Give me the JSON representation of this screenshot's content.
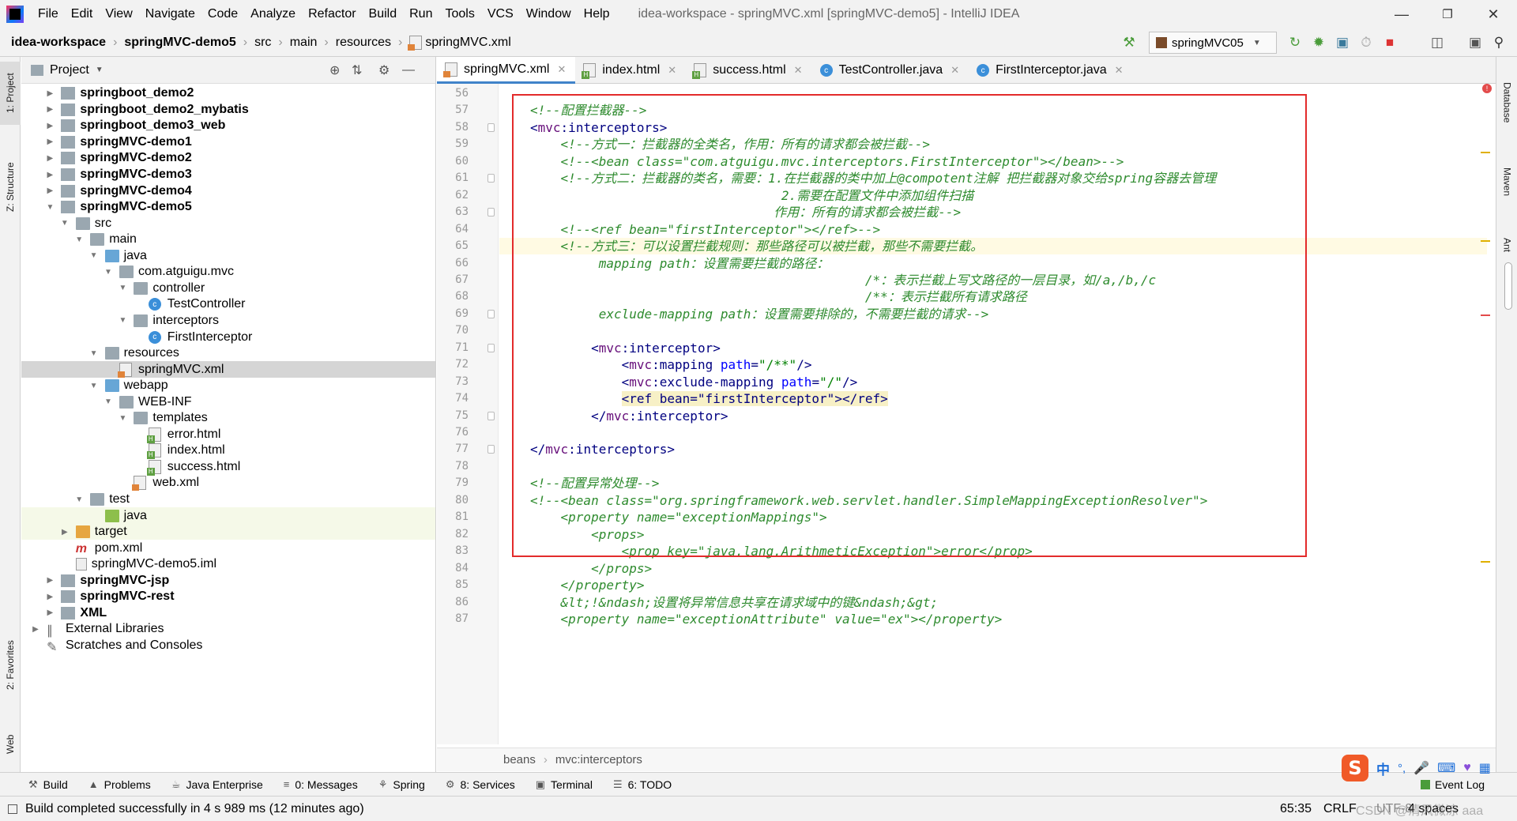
{
  "menubar": {
    "items": [
      "File",
      "Edit",
      "View",
      "Navigate",
      "Code",
      "Analyze",
      "Refactor",
      "Build",
      "Run",
      "Tools",
      "VCS",
      "Window",
      "Help"
    ],
    "window_title": "idea-workspace - springMVC.xml [springMVC-demo5] - IntelliJ IDEA",
    "minimize": "—",
    "maximize": "❐",
    "close": "✕"
  },
  "navbar": {
    "crumbs": [
      "idea-workspace",
      "springMVC-demo5",
      "src",
      "main",
      "resources",
      "springMVC.xml"
    ],
    "run_config": "springMVC05",
    "dropdown": "▼"
  },
  "left_stripe": {
    "project": "1: Project",
    "structure": "Z: Structure",
    "favorites": "2: Favorites",
    "web": "Web"
  },
  "project_panel": {
    "title": "Project",
    "tree": [
      {
        "label": "springboot_demo2",
        "depth": 1,
        "arrow": "▶",
        "icon": "module",
        "bold": true
      },
      {
        "label": "springboot_demo2_mybatis",
        "depth": 1,
        "arrow": "▶",
        "icon": "module",
        "bold": true
      },
      {
        "label": "springboot_demo3_web",
        "depth": 1,
        "arrow": "▶",
        "icon": "module",
        "bold": true
      },
      {
        "label": "springMVC-demo1",
        "depth": 1,
        "arrow": "▶",
        "icon": "module",
        "bold": true
      },
      {
        "label": "springMVC-demo2",
        "depth": 1,
        "arrow": "▶",
        "icon": "module",
        "bold": true
      },
      {
        "label": "springMVC-demo3",
        "depth": 1,
        "arrow": "▶",
        "icon": "module",
        "bold": true
      },
      {
        "label": "springMVC-demo4",
        "depth": 1,
        "arrow": "▶",
        "icon": "module",
        "bold": true
      },
      {
        "label": "springMVC-demo5",
        "depth": 1,
        "arrow": "▼",
        "icon": "module",
        "bold": true
      },
      {
        "label": "src",
        "depth": 2,
        "arrow": "▼",
        "icon": "folder"
      },
      {
        "label": "main",
        "depth": 3,
        "arrow": "▼",
        "icon": "folder"
      },
      {
        "label": "java",
        "depth": 4,
        "arrow": "▼",
        "icon": "folder-blue"
      },
      {
        "label": "com.atguigu.mvc",
        "depth": 5,
        "arrow": "▼",
        "icon": "folder"
      },
      {
        "label": "controller",
        "depth": 6,
        "arrow": "▼",
        "icon": "folder"
      },
      {
        "label": "TestController",
        "depth": 7,
        "arrow": "",
        "icon": "class"
      },
      {
        "label": "interceptors",
        "depth": 6,
        "arrow": "▼",
        "icon": "folder"
      },
      {
        "label": "FirstInterceptor",
        "depth": 7,
        "arrow": "",
        "icon": "class"
      },
      {
        "label": "resources",
        "depth": 4,
        "arrow": "▼",
        "icon": "folder"
      },
      {
        "label": "springMVC.xml",
        "depth": 5,
        "arrow": "",
        "icon": "xml",
        "selected": true
      },
      {
        "label": "webapp",
        "depth": 4,
        "arrow": "▼",
        "icon": "folder-blue"
      },
      {
        "label": "WEB-INF",
        "depth": 5,
        "arrow": "▼",
        "icon": "folder"
      },
      {
        "label": "templates",
        "depth": 6,
        "arrow": "▼",
        "icon": "folder"
      },
      {
        "label": "error.html",
        "depth": 7,
        "arrow": "",
        "icon": "html"
      },
      {
        "label": "index.html",
        "depth": 7,
        "arrow": "",
        "icon": "html"
      },
      {
        "label": "success.html",
        "depth": 7,
        "arrow": "",
        "icon": "html"
      },
      {
        "label": "web.xml",
        "depth": 6,
        "arrow": "",
        "icon": "xml"
      },
      {
        "label": "test",
        "depth": 3,
        "arrow": "▼",
        "icon": "folder"
      },
      {
        "label": "java",
        "depth": 4,
        "arrow": "",
        "icon": "folder-green",
        "highlight": true
      },
      {
        "label": "target",
        "depth": 2,
        "arrow": "▶",
        "icon": "folder-orange",
        "highlight": true
      },
      {
        "label": "pom.xml",
        "depth": 2,
        "arrow": "",
        "icon": "maven"
      },
      {
        "label": "springMVC-demo5.iml",
        "depth": 2,
        "arrow": "",
        "icon": "iml"
      },
      {
        "label": "springMVC-jsp",
        "depth": 1,
        "arrow": "▶",
        "icon": "module",
        "bold": true
      },
      {
        "label": "springMVC-rest",
        "depth": 1,
        "arrow": "▶",
        "icon": "module",
        "bold": true
      },
      {
        "label": "XML",
        "depth": 1,
        "arrow": "▶",
        "icon": "module",
        "bold": true
      },
      {
        "label": "External Libraries",
        "depth": 0,
        "arrow": "▶",
        "icon": "libs"
      },
      {
        "label": "Scratches and Consoles",
        "depth": 0,
        "arrow": "",
        "icon": "scratch"
      }
    ]
  },
  "tabs": [
    {
      "label": "springMVC.xml",
      "icon": "xml",
      "active": true
    },
    {
      "label": "index.html",
      "icon": "html"
    },
    {
      "label": "success.html",
      "icon": "html"
    },
    {
      "label": "TestController.java",
      "icon": "class"
    },
    {
      "label": "FirstInterceptor.java",
      "icon": "class"
    }
  ],
  "editor": {
    "first_line": 56,
    "current_line": 65,
    "lines": [
      [],
      [
        [
          "cmt",
          "<!--配置拦截器-->"
        ]
      ],
      [
        [
          "tag",
          "<"
        ],
        [
          "ns",
          "mvc"
        ],
        [
          "tag",
          ":interceptors>"
        ]
      ],
      [
        [
          "cmt",
          "    <!--方式一：拦截器的全类名，作用：所有的请求都会被拦截-->"
        ]
      ],
      [
        [
          "cmt",
          "    <!--<bean class=\"com.atguigu.mvc.interceptors.FirstInterceptor\"></bean>-->"
        ]
      ],
      [
        [
          "cmt",
          "    <!--方式二：拦截器的类名，需要：1.在拦截器的类中加上@compotent注解 把拦截器对象交给spring容器去管理"
        ]
      ],
      [
        [
          "cmt",
          "                                 2.需要在配置文件中添加组件扫描"
        ]
      ],
      [
        [
          "cmt",
          "                                作用：所有的请求都会被拦截-->"
        ]
      ],
      [
        [
          "cmt",
          "    <!--<ref bean=\"firstInterceptor\"></ref>-->"
        ]
      ],
      [
        [
          "cmt",
          "    <!--方式三：可以设置拦截规则：那些路径可以被拦截，那些不需要拦截。"
        ]
      ],
      [
        [
          "cmt",
          "         mapping path：设置需要拦截的路径："
        ]
      ],
      [
        [
          "cmt",
          "                                            /*：表示拦截上写文路径的一层目录，如/a,/b,/c"
        ]
      ],
      [
        [
          "cmt",
          "                                            /**：表示拦截所有请求路径"
        ]
      ],
      [
        [
          "cmt",
          "         exclude-mapping path：设置需要排除的，不需要拦截的请求-->"
        ]
      ],
      [],
      [
        [
          "tag",
          "        <"
        ],
        [
          "ns",
          "mvc"
        ],
        [
          "tag",
          ":interceptor>"
        ]
      ],
      [
        [
          "tag",
          "            <"
        ],
        [
          "ns",
          "mvc"
        ],
        [
          "tag",
          ":mapping "
        ],
        [
          "attr",
          "path"
        ],
        [
          "tag",
          "="
        ],
        [
          "str",
          "\"/**\""
        ],
        [
          "tag",
          "/>"
        ]
      ],
      [
        [
          "tag",
          "            <"
        ],
        [
          "ns",
          "mvc"
        ],
        [
          "tag",
          ":exclude-mapping "
        ],
        [
          "attr",
          "path"
        ],
        [
          "tag",
          "="
        ],
        [
          "str",
          "\"/\""
        ],
        [
          "tag",
          "/>"
        ]
      ],
      [
        [
          "tag",
          "            "
        ],
        [
          "refhl",
          "<ref bean=\"firstInterceptor\"></ref>"
        ]
      ],
      [
        [
          "tag",
          "        </"
        ],
        [
          "ns",
          "mvc"
        ],
        [
          "tag",
          ":interceptor>"
        ]
      ],
      [],
      [
        [
          "tag",
          "</"
        ],
        [
          "ns",
          "mvc"
        ],
        [
          "tag",
          ":interceptors>"
        ]
      ],
      [],
      [
        [
          "cmt",
          "<!--配置异常处理-->"
        ]
      ],
      [
        [
          "cmt",
          "<!--<bean class=\"org.springframework.web.servlet.handler.SimpleMappingExceptionResolver\">"
        ]
      ],
      [
        [
          "cmt",
          "    <property name=\"exceptionMappings\">"
        ]
      ],
      [
        [
          "cmt",
          "        <props>"
        ]
      ],
      [
        [
          "cmt",
          "            <prop key=\"java.lang.ArithmeticException\">error</prop>"
        ]
      ],
      [
        [
          "cmt",
          "        </props>"
        ]
      ],
      [
        [
          "cmt",
          "    </property>"
        ]
      ],
      [
        [
          "cmt",
          "    &lt;!&ndash;设置将异常信息共享在请求域中的键&ndash;&gt;"
        ]
      ],
      [
        [
          "cmt",
          "    <property name=\"exceptionAttribute\" value=\"ex\"></property>"
        ]
      ]
    ],
    "breadcrumb": [
      "beans",
      "mvc:interceptors"
    ]
  },
  "right_stripe": {
    "database": "Database",
    "maven": "Maven",
    "ant": "Ant"
  },
  "bottom_tools": [
    {
      "label": "Build",
      "icon": "hammer-icon"
    },
    {
      "label": "Problems",
      "icon": "warning-icon"
    },
    {
      "label": "Java Enterprise",
      "icon": "java-ee-icon"
    },
    {
      "label": "0: Messages",
      "icon": "messages-icon"
    },
    {
      "label": "Spring",
      "icon": "spring-icon"
    },
    {
      "label": "8: Services",
      "icon": "services-icon"
    },
    {
      "label": "Terminal",
      "icon": "terminal-icon"
    },
    {
      "label": "6: TODO",
      "icon": "todo-icon"
    }
  ],
  "event_log": "Event Log",
  "status": {
    "message": "Build completed successfully in 4 s 989 ms (12 minutes ago)",
    "position": "65:35",
    "line_sep": "CRLF",
    "encoding": "UTF-8",
    "indent": "4 spaces",
    "watermark": "CSDN @清风微凉 aaa"
  },
  "ime": {
    "logo": "S",
    "lang": "中",
    "punct": "°,"
  }
}
